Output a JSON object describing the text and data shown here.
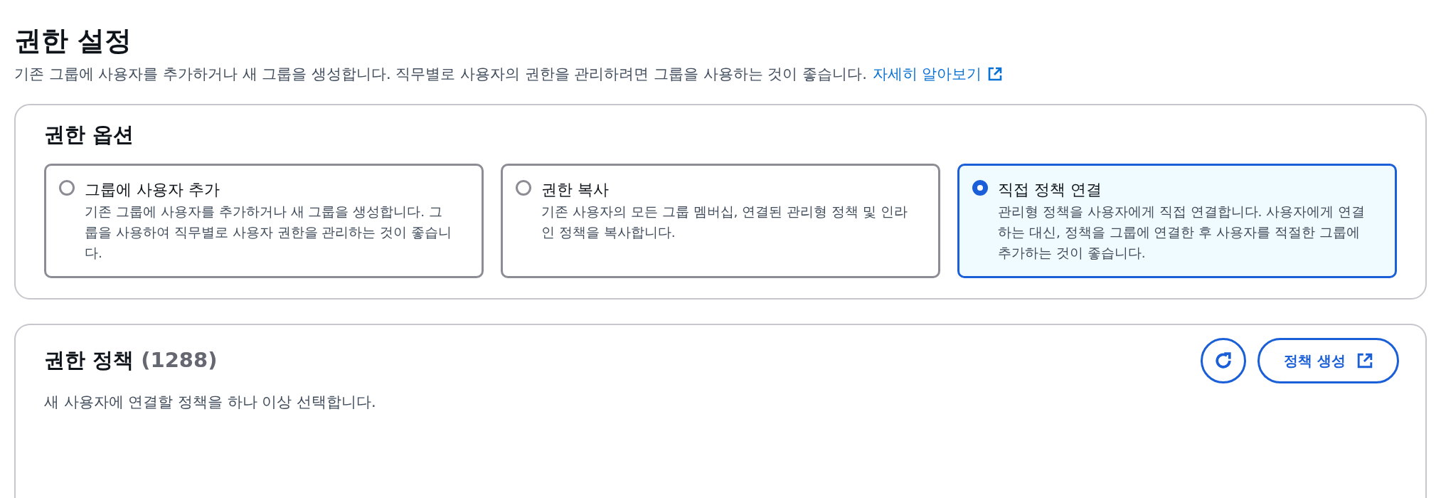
{
  "header": {
    "title": "권한 설정",
    "description": "기존 그룹에 사용자를 추가하거나 새 그룹을 생성합니다. 직무별로 사용자의 권한을 관리하려면 그룹을 사용하는 것이 좋습니다.",
    "link": "자세히 알아보기"
  },
  "permission_options": {
    "title": "권한 옵션",
    "options": [
      {
        "label": "그룹에 사용자 추가",
        "description": "기존 그룹에 사용자를 추가하거나 새 그룹을 생성합니다. 그룹을 사용하여 직무별로 사용자 권한을 관리하는 것이 좋습니다.",
        "selected": false
      },
      {
        "label": "권한 복사",
        "description": "기존 사용자의 모든 그룹 멤버십, 연결된 관리형 정책 및 인라인 정책을 복사합니다.",
        "selected": false
      },
      {
        "label": "직접 정책 연결",
        "description": "관리형 정책을 사용자에게 직접 연결합니다. 사용자에게 연결하는 대신, 정책을 그룹에 연결한 후 사용자를 적절한 그룹에 추가하는 것이 좋습니다.",
        "selected": true
      }
    ]
  },
  "policies": {
    "title": "권한 정책",
    "count": "(1288)",
    "description": "새 사용자에 연결할 정책을 하나 이상 선택합니다.",
    "create_button": "정책 생성"
  }
}
